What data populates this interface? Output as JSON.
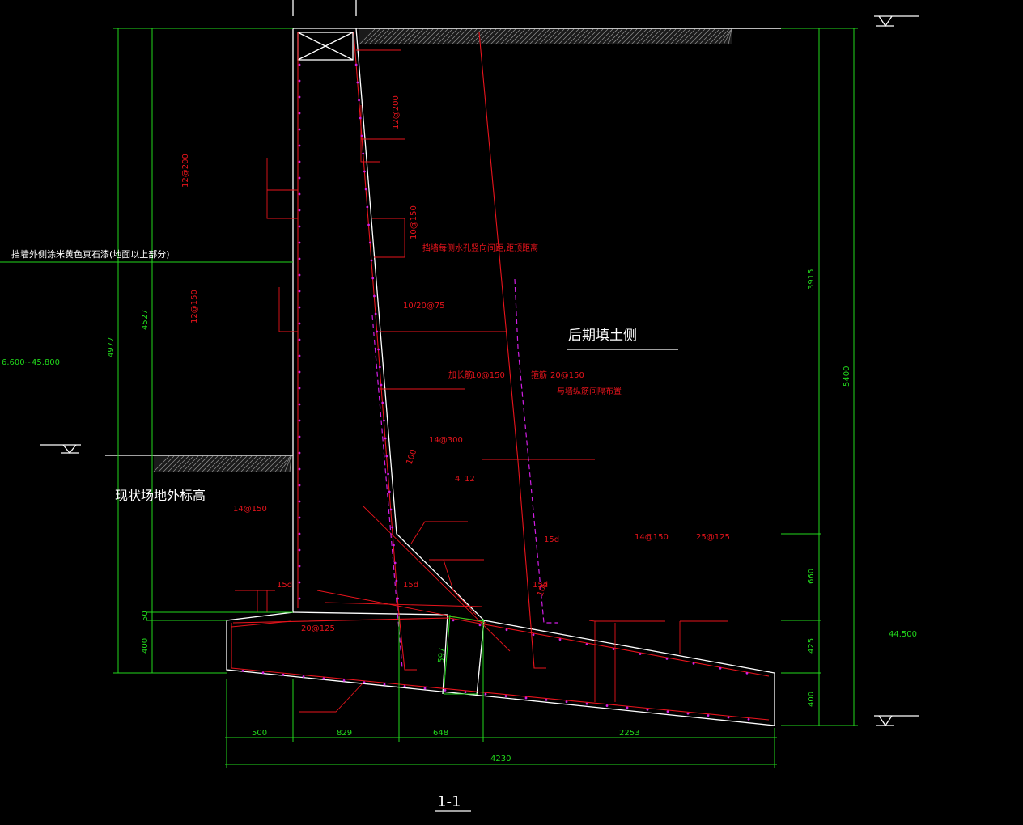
{
  "drawing": {
    "section_title": "1-1",
    "fill_side_label": "后期填土侧",
    "existing_grade_label": "现状场地外标高",
    "facing_note": "挡墙外侧涂米黄色真石漆(地面以上部分)",
    "elevation_left": "6.600~45.800",
    "elevation_right": "44.500",
    "colors": {
      "background": "#000000",
      "outline": "#ffffff",
      "rebar": "#e8141c",
      "dimension": "#22d81c",
      "stirrup": "#d21ee6"
    }
  },
  "rebar_labels": {
    "r1": "12@200",
    "r2": "12@200",
    "r3": "10@150",
    "r4": "挡墙每侧水孔竖向间距,距顶距离",
    "r5": "10/20@75",
    "r6": "12@150",
    "r7": "加长筋",
    "r8": "10@150",
    "r9": "箍筋",
    "r10": "20@150",
    "r11": "与墙纵筋间隔布置",
    "r12": "14@300",
    "r13": "100",
    "r14": "4",
    "r15": "12",
    "r16": "14@150",
    "r17": "15d",
    "r18": "15d",
    "r19": "14@150",
    "r20": "25@125",
    "r21": "15d",
    "r22": "15d",
    "r23": "100",
    "r24": "20@125"
  },
  "dimensions": {
    "left_total": "4977",
    "left_wall": "4527",
    "left_50": "50",
    "left_400": "400",
    "right_total": "5400",
    "right_upper": "3915",
    "right_660": "660",
    "right_425": "425",
    "right_400": "400",
    "bottom_500": "500",
    "bottom_829": "829",
    "bottom_648": "648",
    "bottom_2253": "2253",
    "bottom_total": "4230",
    "key_597": "597"
  }
}
